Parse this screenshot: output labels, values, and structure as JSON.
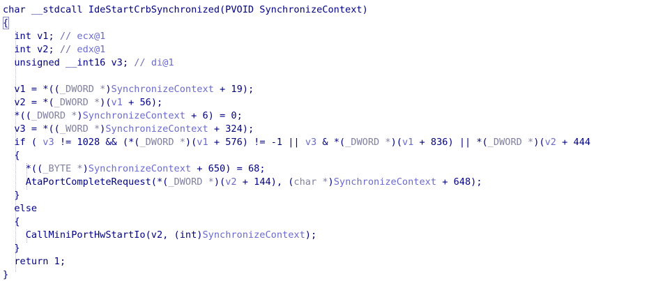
{
  "editor": {
    "lines": [
      [
        {
          "t": "char __stdcall IdeStartCrbSynchronized(PVOID SynchronizeContext)",
          "c": "kw"
        }
      ],
      [
        {
          "t": "{",
          "c": "kw"
        }
      ],
      [
        {
          "t": "  int v1; ",
          "c": "kw"
        },
        {
          "t": "// ",
          "c": "cmt"
        },
        {
          "t": "ecx@1",
          "c": "ref"
        }
      ],
      [
        {
          "t": "  int v2; ",
          "c": "kw"
        },
        {
          "t": "// ",
          "c": "cmt"
        },
        {
          "t": "edx@1",
          "c": "ref"
        }
      ],
      [
        {
          "t": "  unsigned __int16 v3; ",
          "c": "kw"
        },
        {
          "t": "// ",
          "c": "cmt"
        },
        {
          "t": "di@1",
          "c": "ref"
        }
      ],
      [
        {
          "t": "",
          "c": "kw"
        }
      ],
      [
        {
          "t": "  v1 = *((",
          "c": "kw"
        },
        {
          "t": "_DWORD *",
          "c": "cast"
        },
        {
          "t": ")",
          "c": "kw"
        },
        {
          "t": "SynchronizeContext",
          "c": "ref"
        },
        {
          "t": " + 19);",
          "c": "kw"
        }
      ],
      [
        {
          "t": "  v2 = *(",
          "c": "kw"
        },
        {
          "t": "_DWORD *",
          "c": "cast"
        },
        {
          "t": ")(",
          "c": "kw"
        },
        {
          "t": "v1",
          "c": "ref"
        },
        {
          "t": " + 56);",
          "c": "kw"
        }
      ],
      [
        {
          "t": "  *((",
          "c": "kw"
        },
        {
          "t": "_DWORD *",
          "c": "cast"
        },
        {
          "t": ")",
          "c": "kw"
        },
        {
          "t": "SynchronizeContext",
          "c": "ref"
        },
        {
          "t": " + 6) = 0;",
          "c": "kw"
        }
      ],
      [
        {
          "t": "  v3 = *((",
          "c": "kw"
        },
        {
          "t": "_WORD *",
          "c": "cast"
        },
        {
          "t": ")",
          "c": "kw"
        },
        {
          "t": "SynchronizeContext",
          "c": "ref"
        },
        {
          "t": " + 324);",
          "c": "kw"
        }
      ],
      [
        {
          "t": "  if ( ",
          "c": "kw"
        },
        {
          "t": "v3",
          "c": "ref"
        },
        {
          "t": " != 1028 && (*(",
          "c": "kw"
        },
        {
          "t": "_DWORD *",
          "c": "cast"
        },
        {
          "t": ")(",
          "c": "kw"
        },
        {
          "t": "v1",
          "c": "ref"
        },
        {
          "t": " + 576) != -1 || ",
          "c": "kw"
        },
        {
          "t": "v3",
          "c": "ref"
        },
        {
          "t": " & *(",
          "c": "kw"
        },
        {
          "t": "_DWORD *",
          "c": "cast"
        },
        {
          "t": ")(",
          "c": "kw"
        },
        {
          "t": "v1",
          "c": "ref"
        },
        {
          "t": " + 836) || *(",
          "c": "kw"
        },
        {
          "t": "_DWORD *",
          "c": "cast"
        },
        {
          "t": ")(",
          "c": "kw"
        },
        {
          "t": "v2",
          "c": "ref"
        },
        {
          "t": " + 444",
          "c": "kw"
        }
      ],
      [
        {
          "t": "  {",
          "c": "kw"
        }
      ],
      [
        {
          "t": "    *((",
          "c": "kw"
        },
        {
          "t": "_BYTE *",
          "c": "cast"
        },
        {
          "t": ")",
          "c": "kw"
        },
        {
          "t": "SynchronizeContext",
          "c": "ref"
        },
        {
          "t": " + 650) = 68;",
          "c": "kw"
        }
      ],
      [
        {
          "t": "    AtaPortCompleteRequest(*(",
          "c": "kw"
        },
        {
          "t": "_DWORD *",
          "c": "cast"
        },
        {
          "t": ")(",
          "c": "kw"
        },
        {
          "t": "v2",
          "c": "ref"
        },
        {
          "t": " + 144), (",
          "c": "kw"
        },
        {
          "t": "char *",
          "c": "cast"
        },
        {
          "t": ")",
          "c": "kw"
        },
        {
          "t": "SynchronizeContext",
          "c": "ref"
        },
        {
          "t": " + 648);",
          "c": "kw"
        }
      ],
      [
        {
          "t": "  }",
          "c": "kw"
        }
      ],
      [
        {
          "t": "  else",
          "c": "kw"
        }
      ],
      [
        {
          "t": "  {",
          "c": "kw"
        }
      ],
      [
        {
          "t": "    CallMiniPortHwStartIo(v2, (int)",
          "c": "kw"
        },
        {
          "t": "SynchronizeContext",
          "c": "ref"
        },
        {
          "t": ");",
          "c": "kw"
        }
      ],
      [
        {
          "t": "  }",
          "c": "kw"
        }
      ],
      [
        {
          "t": "  return 1;",
          "c": "kw"
        }
      ],
      [
        {
          "t": "}",
          "c": "kw"
        }
      ]
    ]
  }
}
